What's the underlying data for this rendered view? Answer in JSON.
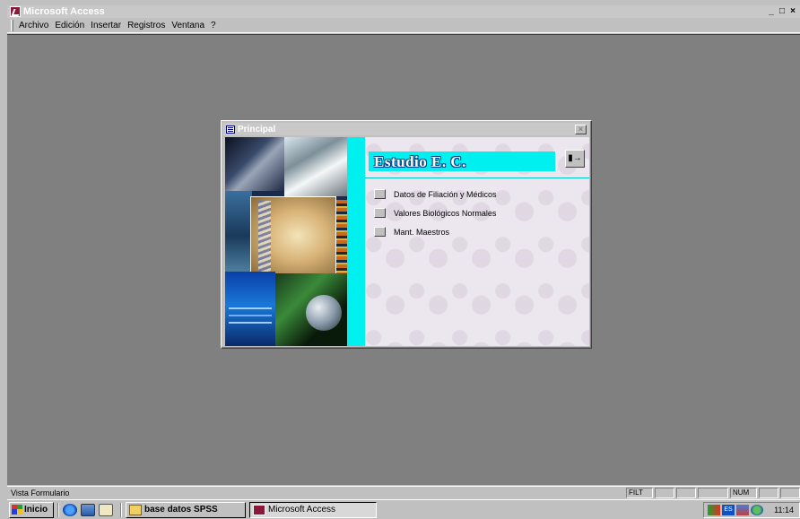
{
  "app": {
    "title": "Microsoft Access",
    "window_controls": [
      "_",
      "4",
      "x"
    ]
  },
  "menubar": {
    "items": [
      "Archivo",
      "Edición",
      "Insertar",
      "Registros",
      "Ventana",
      "?"
    ]
  },
  "form": {
    "title": "Principal",
    "close_label": "x",
    "heading": "Estudio E. C.",
    "exit_icon": "door-exit-icon",
    "options": [
      {
        "label": "Datos de Filiación y Médicos"
      },
      {
        "label": "Valores Biológicos Normales"
      },
      {
        "label": "Mant. Maestros"
      }
    ]
  },
  "statusbar": {
    "text": "Vista Formulario",
    "indicators": [
      "FILT",
      "",
      "",
      "",
      "NUM",
      "",
      ""
    ]
  },
  "taskbar": {
    "start_label": "Inicio",
    "tasks": [
      {
        "label": "base datos SPSS",
        "icon": "folder-icon"
      },
      {
        "label": "Microsoft Access",
        "icon": "access-icon"
      }
    ],
    "tray_lang": "ES",
    "clock": "11:14"
  },
  "colors": {
    "accent_cyan": "#00f0f0",
    "workspace": "#808080",
    "title_text": "#003a8a"
  }
}
